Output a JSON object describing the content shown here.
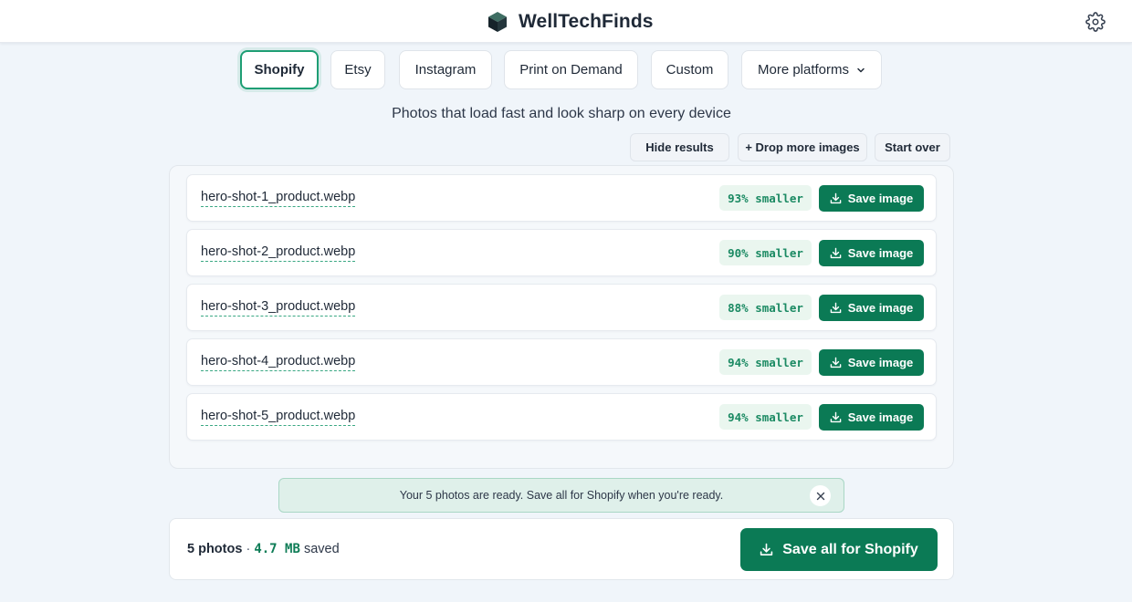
{
  "header": {
    "brand": "WellTechFinds",
    "logo_icon": "cube-icon",
    "settings_icon": "gear-icon"
  },
  "tabs": [
    {
      "label": "Shopify",
      "active": true
    },
    {
      "label": "Etsy"
    },
    {
      "label": "Instagram"
    },
    {
      "label": "Print on Demand"
    },
    {
      "label": "Custom"
    },
    {
      "label": "More platforms",
      "icon": "chevron-down-icon"
    }
  ],
  "subtitle": "Photos that load fast and look sharp on every device",
  "actions": {
    "hide_results": "Hide results",
    "drop_more": "+ Drop more images",
    "start_over": "Start over"
  },
  "results": [
    {
      "filename": "hero-shot-1_product.webp",
      "reduction": "93% smaller",
      "save_label": "Save image"
    },
    {
      "filename": "hero-shot-2_product.webp",
      "reduction": "90% smaller",
      "save_label": "Save image"
    },
    {
      "filename": "hero-shot-3_product.webp",
      "reduction": "88% smaller",
      "save_label": "Save image"
    },
    {
      "filename": "hero-shot-4_product.webp",
      "reduction": "94% smaller",
      "save_label": "Save image"
    },
    {
      "filename": "hero-shot-5_product.webp",
      "reduction": "94% smaller",
      "save_label": "Save image"
    }
  ],
  "toast": {
    "message": "Your 5 photos are ready. Save all for Shopify when you're ready.",
    "close_icon": "close-icon"
  },
  "footer": {
    "photo_count": "5 photos",
    "separator": "·",
    "saved_amount": "4.7 MB",
    "saved_suffix": "saved",
    "save_all_label": "Save all for Shopify"
  },
  "colors": {
    "accent": "#0b7a55",
    "accent_light": "#eaf6ef",
    "active_tab_border": "#1e9e74",
    "toast_bg": "#dff0ea"
  }
}
